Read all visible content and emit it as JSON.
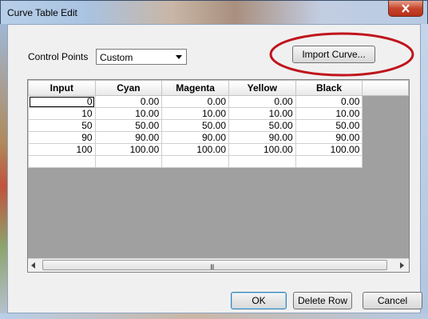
{
  "window": {
    "title": "Curve Table Edit"
  },
  "control_points": {
    "label": "Control Points",
    "selected": "Custom"
  },
  "import_button": {
    "label": "Import Curve..."
  },
  "table": {
    "columns": [
      "Input",
      "Cyan",
      "Magenta",
      "Yellow",
      "Black"
    ],
    "rows": [
      [
        "0",
        "0.00",
        "0.00",
        "0.00",
        "0.00"
      ],
      [
        "10",
        "10.00",
        "10.00",
        "10.00",
        "10.00"
      ],
      [
        "50",
        "50.00",
        "50.00",
        "50.00",
        "50.00"
      ],
      [
        "90",
        "90.00",
        "90.00",
        "90.00",
        "90.00"
      ],
      [
        "100",
        "100.00",
        "100.00",
        "100.00",
        "100.00"
      ]
    ]
  },
  "scrollbar": {
    "grip": "III"
  },
  "buttons": {
    "ok": "OK",
    "delete_row": "Delete Row",
    "cancel": "Cancel"
  },
  "colors": {
    "highlight_ellipse": "#c0141c",
    "grid_background": "#a0a0a0"
  }
}
